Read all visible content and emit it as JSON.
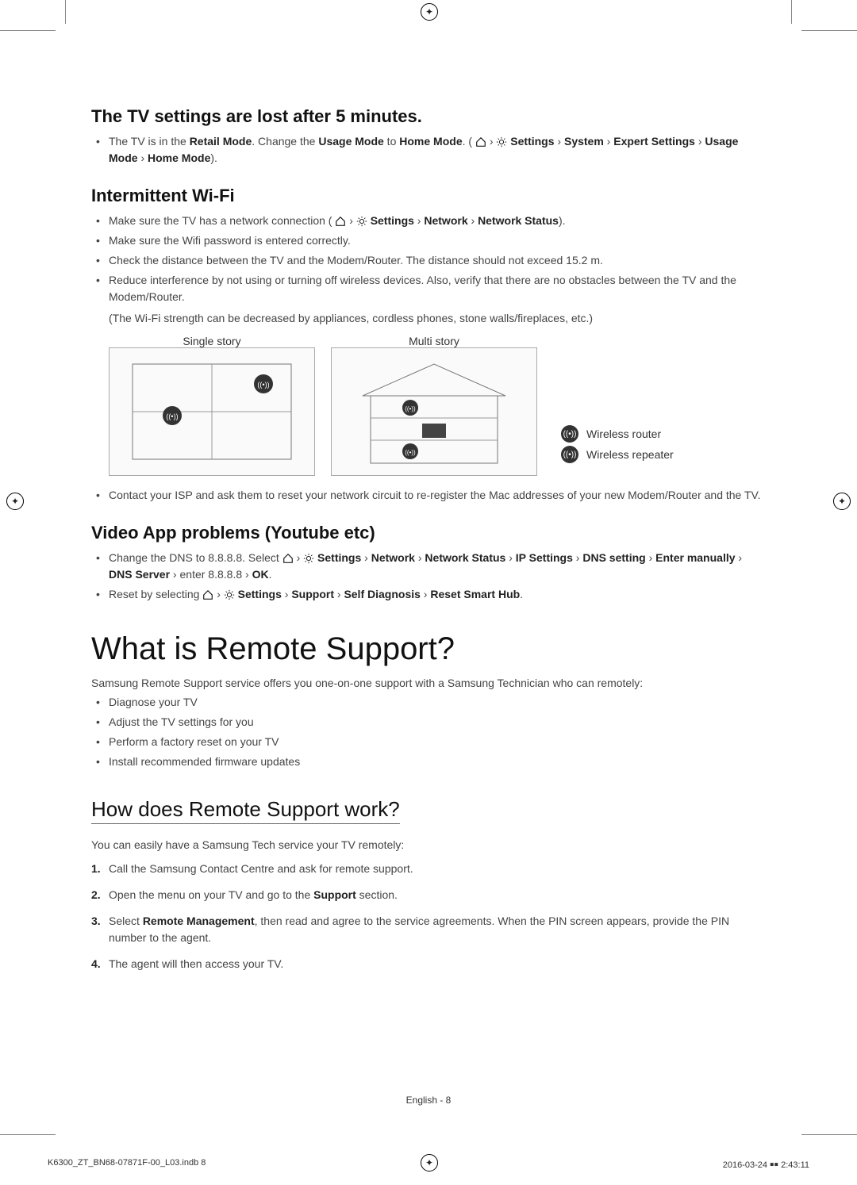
{
  "sections": {
    "lost_settings": {
      "heading": "The TV settings are lost after 5 minutes.",
      "bullet1_pre": "The TV is in the ",
      "bullet1_b1": "Retail Mode",
      "bullet1_mid1": ". Change the ",
      "bullet1_b2": "Usage Mode",
      "bullet1_mid2": " to ",
      "bullet1_b3": "Home Mode",
      "bullet1_mid3": ". (",
      "bullet1_path_settings": " Settings",
      "bullet1_path_system": "System",
      "bullet1_path_expert": "Expert Settings",
      "bullet1_path_usage": "Usage Mode",
      "bullet1_path_home": "Home Mode",
      "bullet1_end": ")."
    },
    "wifi": {
      "heading": "Intermittent Wi-Fi",
      "b1_pre": "Make sure the TV has a network connection (",
      "b1_path_settings": " Settings",
      "b1_path_network": "Network",
      "b1_path_status": "Network Status",
      "b1_end": ").",
      "b2": "Make sure the Wifi password is entered correctly.",
      "b3": "Check the distance between the TV and the Modem/Router. The distance should not exceed 15.2 m.",
      "b4": "Reduce interference by not using or turning off wireless devices. Also, verify that there are no obstacles between the TV and the Modem/Router.",
      "b4_note": "(The Wi-Fi strength can be decreased by appliances, cordless phones, stone walls/fireplaces, etc.)",
      "diagram_single": "Single story",
      "diagram_multi": "Multi story",
      "legend_router": "Wireless router",
      "legend_repeater": "Wireless repeater",
      "b5": "Contact your ISP and ask them to reset your network circuit to re-register the Mac addresses of your new Modem/Router and the TV."
    },
    "video_app": {
      "heading": "Video App problems (Youtube etc)",
      "b1_pre": "Change the DNS to 8.8.8.8. Select ",
      "b1_settings": " Settings",
      "b1_network": "Network",
      "b1_status": "Network Status",
      "b1_ip": "IP Settings",
      "b1_dns": "DNS setting",
      "b1_enter": "Enter manually",
      "b1_server": "DNS Server",
      "b1_mid": " enter 8.8.8.8 ",
      "b1_ok": "OK",
      "b2_pre": "Reset by selecting ",
      "b2_settings": " Settings",
      "b2_support": "Support",
      "b2_self": "Self Diagnosis",
      "b2_reset": "Reset Smart Hub"
    },
    "remote_support": {
      "main_heading": "What is Remote Support?",
      "intro": "Samsung Remote Support service offers you one-on-one support with a Samsung Technician who can remotely:",
      "b1": "Diagnose your TV",
      "b2": "Adjust the TV settings for you",
      "b3": "Perform a factory reset on your TV",
      "b4": "Install recommended firmware updates"
    },
    "how_works": {
      "heading": "How does Remote Support work?",
      "intro": "You can easily have a Samsung Tech service your TV remotely:",
      "s1": "Call the Samsung Contact Centre and ask for remote support.",
      "s2_pre": "Open the menu on your TV and go to the ",
      "s2_b": "Support",
      "s2_post": " section.",
      "s3_pre": "Select ",
      "s3_b": "Remote Management",
      "s3_post": ", then read and agree to the service agreements. When the PIN screen appears, provide the PIN number to the agent.",
      "s4": "The agent will then access your TV."
    }
  },
  "footer": {
    "page_label": "English - 8",
    "file": "K6300_ZT_BN68-07871F-00_L03.indb   8",
    "timestamp": "2016-03-24   ￭￭ 2:43:11"
  },
  "symbols": {
    "arrow": " › "
  }
}
